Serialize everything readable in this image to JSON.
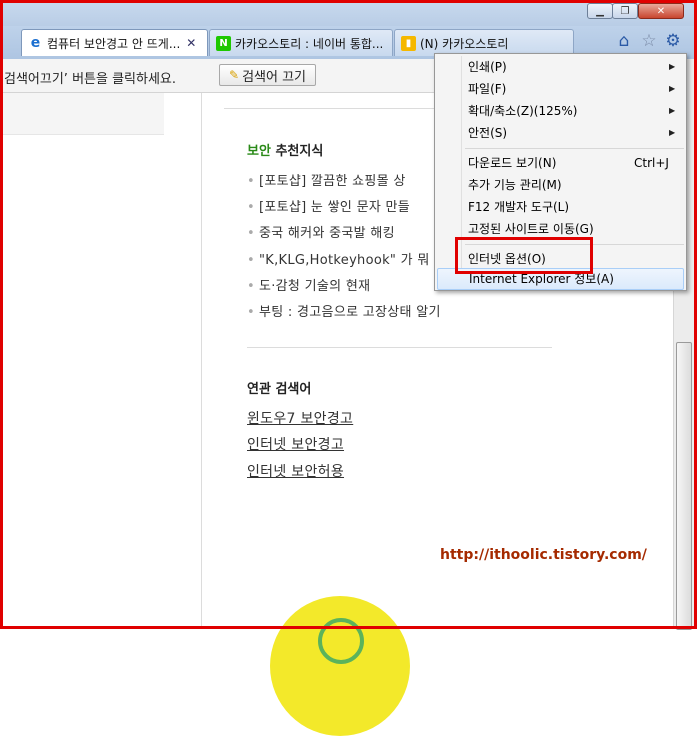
{
  "window": {
    "minimize_icon": "minimize-icon",
    "maximize_icon": "maximize-icon",
    "close_icon": "close-icon"
  },
  "tabs": [
    {
      "label": "컴퓨터 보안경고 안 뜨게...",
      "icon": "ie-icon",
      "active": true,
      "close": "✕"
    },
    {
      "label": "카카오스토리 : 네이버 통합...",
      "icon": "naver-icon",
      "fav_text": "N",
      "active": false
    },
    {
      "label": "(N) 카카오스토리",
      "icon": "kakaostory-icon",
      "active": false
    }
  ],
  "toolbar_icons": [
    "home-icon",
    "favorites-star-icon",
    "tools-gear-icon"
  ],
  "search_bar": {
    "text": "검색어끄기’ 버튼을 클릭하세요.",
    "stop_button_label": "검색어 끄기"
  },
  "content": {
    "section_title_green": "보안",
    "section_title_rest": " 추천지식",
    "list": [
      "[포토샵] 깔끔한 쇼핑몰 상",
      "[포토샵] 눈 쌓인 문자 만들",
      "중국 해커와 중국발 해킹",
      "\"K,KLG,Hotkeyhook\" 가 뭐",
      "도·감청 기술의 현재",
      "부팅 : 경고음으로 고장상태 알기"
    ],
    "related_title": "연관 검색어",
    "related_links": [
      "윈도우7 보안경고",
      "인터넷 보안경고",
      "인터넷 보안허용"
    ],
    "watermark": "http://ithoolic.tistory.com/"
  },
  "menu": {
    "items": [
      {
        "label": "인쇄(P)",
        "submenu": true
      },
      {
        "label": "파일(F)",
        "submenu": true
      },
      {
        "label": "확대/축소(Z)(125%)",
        "submenu": true
      },
      {
        "label": "안전(S)",
        "submenu": true
      },
      {
        "label": "다운로드 보기(N)",
        "shortcut": "Ctrl+J"
      },
      {
        "label": "추가 기능 관리(M)"
      },
      {
        "label": "F12 개발자 도구(L)"
      },
      {
        "label": "고정된 사이트로 이동(G)"
      },
      {
        "label": "인터넷 옵션(O)"
      },
      {
        "label": "Internet Explorer 정보(A)"
      }
    ],
    "arrow": "▶"
  },
  "colors": {
    "highlight_box": "#e00000",
    "accent_green": "#2a8a18",
    "watermark": "#a52a00"
  }
}
